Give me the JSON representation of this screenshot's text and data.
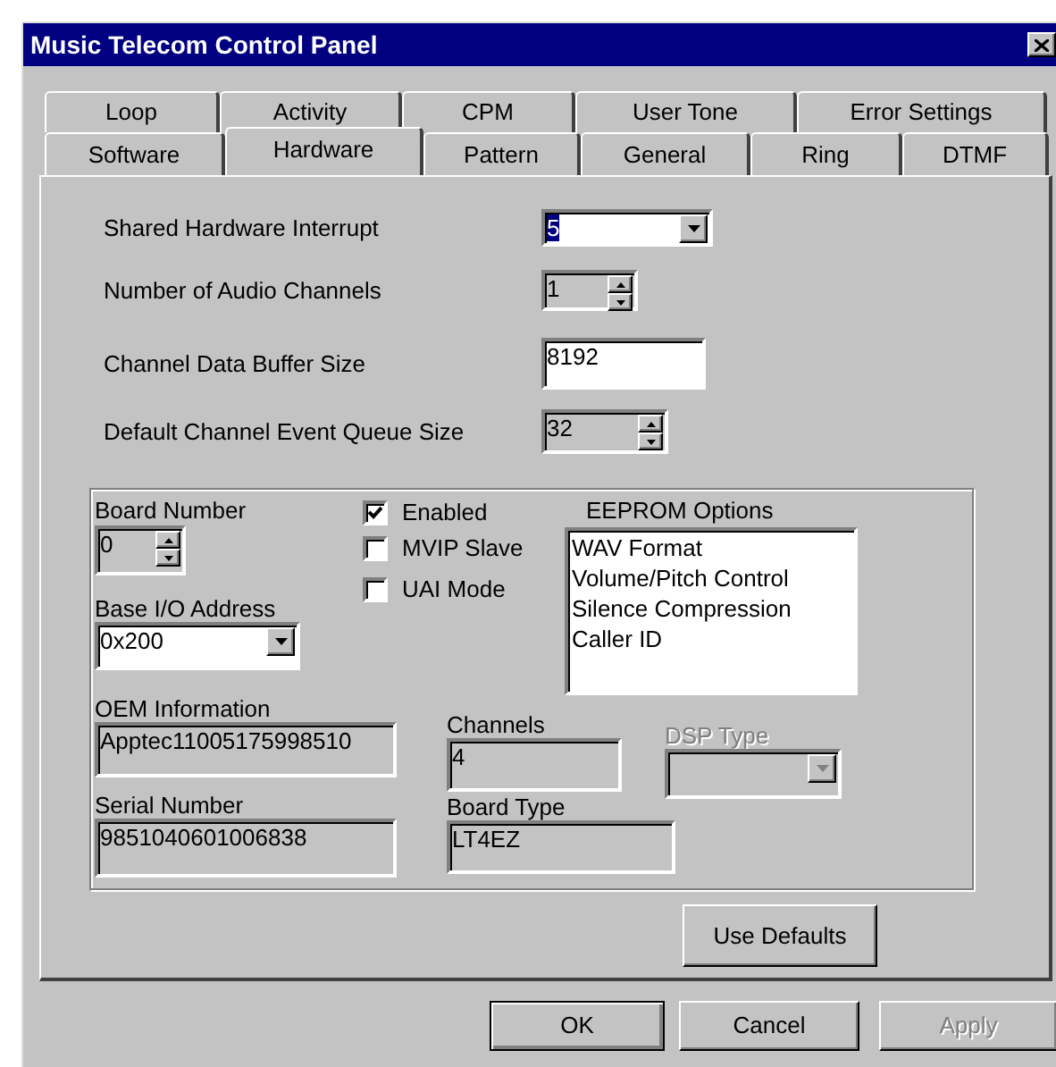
{
  "window": {
    "title": "Music Telecom Control Panel"
  },
  "tab_rows": [
    [
      {
        "label": "Loop",
        "selected": false
      },
      {
        "label": "Activity",
        "selected": false
      },
      {
        "label": "CPM",
        "selected": false
      },
      {
        "label": "User Tone",
        "selected": false
      },
      {
        "label": "Error Settings",
        "selected": false
      }
    ],
    [
      {
        "label": "Software",
        "selected": false
      },
      {
        "label": "Hardware",
        "selected": true
      },
      {
        "label": "Pattern",
        "selected": false
      },
      {
        "label": "General",
        "selected": false
      },
      {
        "label": "Ring",
        "selected": false
      },
      {
        "label": "DTMF",
        "selected": false
      }
    ]
  ],
  "settings": [
    {
      "kind": "combo",
      "label": "Shared Hardware Interrupt",
      "value": "5",
      "highlighted": true,
      "read_only": false
    },
    {
      "kind": "spin",
      "label": "Number of Audio Channels",
      "value": "1",
      "read_only": true
    },
    {
      "kind": "text",
      "label": "Channel Data Buffer Size",
      "value": "8192",
      "read_only": false
    },
    {
      "kind": "spin",
      "label": "Default Channel Event Queue Size",
      "value": "32",
      "read_only": true
    }
  ],
  "board": {
    "board_number": {
      "label": "Board Number",
      "value": "0",
      "read_only": true
    },
    "base_io": {
      "label": "Base I/O Address",
      "value": "0x200",
      "read_only": false
    },
    "checkboxes": [
      {
        "label": "Enabled",
        "checked": true
      },
      {
        "label": "MVIP Slave",
        "checked": false
      },
      {
        "label": "UAI Mode",
        "checked": false
      }
    ],
    "eeprom_options": {
      "label": "EEPROM Options",
      "items": [
        "WAV Format",
        "Volume/Pitch Control",
        "Silence Compression",
        "Caller ID"
      ]
    },
    "oem": {
      "label": "OEM Information",
      "value": "Apptec11005175998510",
      "read_only": true
    },
    "serial": {
      "label": "Serial Number",
      "value": "9851040601006838",
      "read_only": true
    },
    "channels": {
      "label": "Channels",
      "value": "4",
      "read_only": true
    },
    "board_type": {
      "label": "Board Type",
      "value": "LT4EZ",
      "read_only": true
    },
    "dsp_type": {
      "label": "DSP Type",
      "disabled": true
    }
  },
  "use_defaults_button": {
    "label": "Use Defaults"
  },
  "buttons": [
    {
      "label": "OK",
      "default": true,
      "disabled": false
    },
    {
      "label": "Cancel",
      "default": false,
      "disabled": false
    },
    {
      "label": "Apply",
      "default": false,
      "disabled": true
    }
  ]
}
